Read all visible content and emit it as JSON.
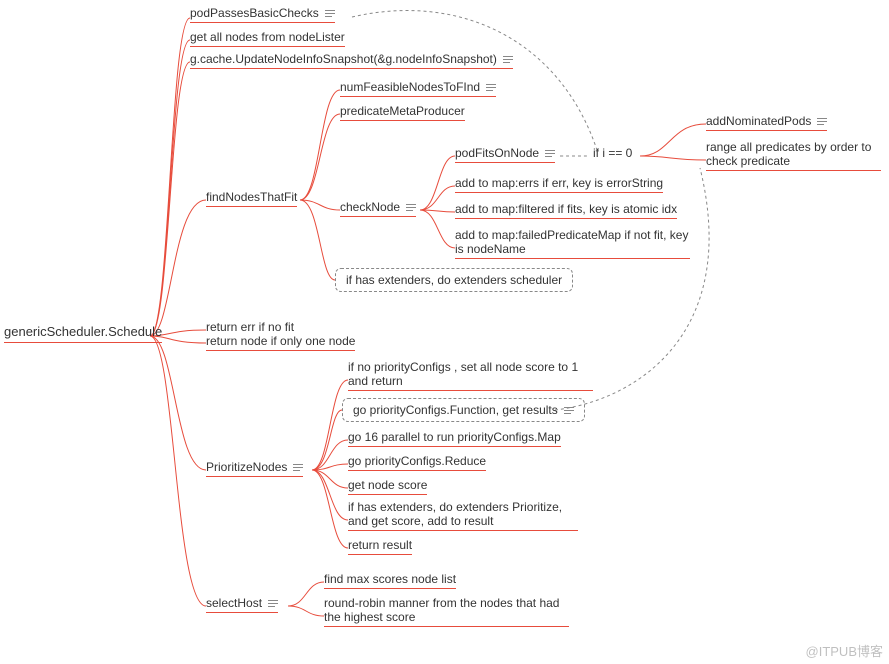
{
  "watermark": "@ITPUB博客",
  "nodes": {
    "root": "genericScheduler.Schedule",
    "podPasses": "podPassesBasicChecks",
    "getAllNodes": "get all nodes from nodeLister",
    "updateSnapshot": "g.cache.UpdateNodeInfoSnapshot(&g.nodeInfoSnapshot)",
    "findNodes": "findNodesThatFit",
    "numFeasible": "numFeasibleNodesToFInd",
    "predicateMeta": "predicateMetaProducer",
    "checkNode": "checkNode",
    "podFits": "podFitsOnNode",
    "ifI0": "if i == 0",
    "addNominated": "addNominatedPods",
    "rangePred": "range all predicates by order to check predicate",
    "mapErr": "add to map:errs if err, key is errorString",
    "mapFiltered": "add to map:filtered if fits, key is atomic idx",
    "mapFailed": "add to map:failedPredicateMap if not fit, key is nodeName",
    "extenders": "if has extenders, do extenders scheduler",
    "retErr": "return err if no fit",
    "retNode": "return node if only one node",
    "prioritize": "PrioritizeNodes",
    "prioNoCfg": "if no priorityConfigs , set all node score to 1 and return",
    "prioFn": "go priorityConfigs.Function, get results",
    "go16": "go 16 parallel to run priorityConfigs.Map",
    "prioReduce": "go priorityConfigs.Reduce",
    "getScore": "get node score",
    "extPrio": "if has extenders, do extenders Prioritize, and get score, add to result",
    "retResult": "return result",
    "selectHost": "selectHost",
    "findMax": "find max scores node list",
    "roundRobin": "round-robin manner from the nodes that had the highest score"
  }
}
